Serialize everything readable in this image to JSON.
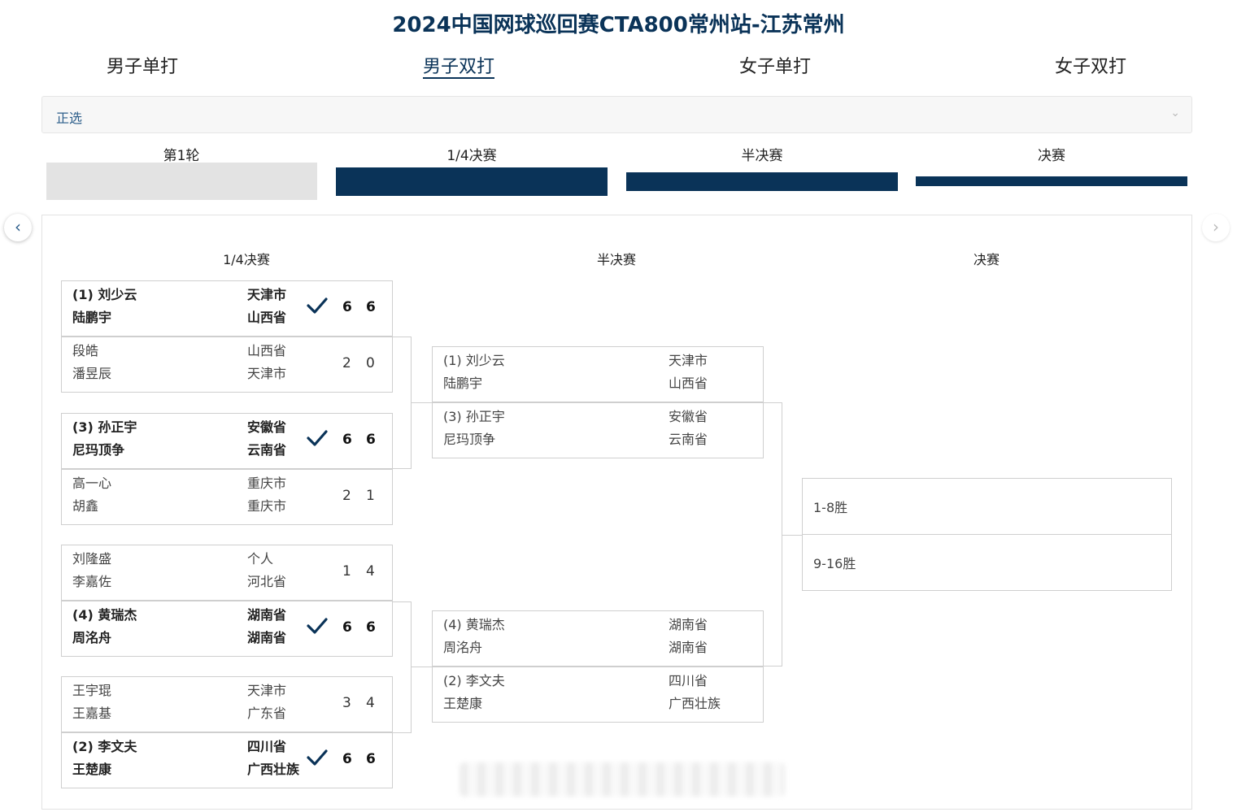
{
  "title": "2024中国网球巡回赛CTA800常州站-江苏常州",
  "event_tabs": [
    "男子单打",
    "男子双打",
    "女子单打",
    "女子双打"
  ],
  "active_event_tab": "男子双打",
  "draw_select": {
    "value": "正选"
  },
  "rounds": [
    "第1轮",
    "1/4决赛",
    "半决赛",
    "决赛"
  ],
  "bracket_columns": [
    "1/4决赛",
    "半决赛",
    "决赛"
  ],
  "colors": {
    "primary": "#0a3358",
    "inactive_bar": "#e3e3e3",
    "border": "#cfcfcf"
  },
  "icons": {
    "prev": "chevron-left-icon",
    "next": "chevron-right-icon",
    "win": "check-icon",
    "dropdown": "chevron-down-icon"
  },
  "quarterfinals": [
    {
      "top": {
        "winner": true,
        "player1": "(1) 刘少云",
        "player2": "陆鹏宇",
        "prov1": "天津市",
        "prov2": "山西省",
        "scores": [
          "6",
          "6"
        ]
      },
      "bottom": {
        "winner": false,
        "player1": "段皓",
        "player2": "潘昱辰",
        "prov1": "山西省",
        "prov2": "天津市",
        "scores": [
          "2",
          "0"
        ]
      }
    },
    {
      "top": {
        "winner": true,
        "player1": "(3) 孙正宇",
        "player2": "尼玛顶争",
        "prov1": "安徽省",
        "prov2": "云南省",
        "scores": [
          "6",
          "6"
        ]
      },
      "bottom": {
        "winner": false,
        "player1": "高一心",
        "player2": "胡鑫",
        "prov1": "重庆市",
        "prov2": "重庆市",
        "scores": [
          "2",
          "1"
        ]
      }
    },
    {
      "top": {
        "winner": false,
        "player1": "刘隆盛",
        "player2": "李嘉佐",
        "prov1": "个人",
        "prov2": "河北省",
        "scores": [
          "1",
          "4"
        ]
      },
      "bottom": {
        "winner": true,
        "player1": "(4) 黄瑞杰",
        "player2": "周洺舟",
        "prov1": "湖南省",
        "prov2": "湖南省",
        "scores": [
          "6",
          "6"
        ]
      }
    },
    {
      "top": {
        "winner": false,
        "player1": "王宇琨",
        "player2": "王嘉基",
        "prov1": "天津市",
        "prov2": "广东省",
        "scores": [
          "3",
          "4"
        ]
      },
      "bottom": {
        "winner": true,
        "player1": "(2) 李文夫",
        "player2": "王楚康",
        "prov1": "四川省",
        "prov2": "广西壮族",
        "scores": [
          "6",
          "6"
        ]
      }
    }
  ],
  "semifinals": [
    {
      "top": {
        "player1": "(1) 刘少云",
        "player2": "陆鹏宇",
        "prov1": "天津市",
        "prov2": "山西省"
      },
      "bottom": {
        "player1": "(3) 孙正宇",
        "player2": "尼玛顶争",
        "prov1": "安徽省",
        "prov2": "云南省"
      }
    },
    {
      "top": {
        "player1": "(4) 黄瑞杰",
        "player2": "周洺舟",
        "prov1": "湖南省",
        "prov2": "湖南省"
      },
      "bottom": {
        "player1": "(2) 李文夫",
        "player2": "王楚康",
        "prov1": "四川省",
        "prov2": "广西壮族"
      }
    }
  ],
  "final": {
    "top": "1-8胜",
    "bottom": "9-16胜"
  }
}
